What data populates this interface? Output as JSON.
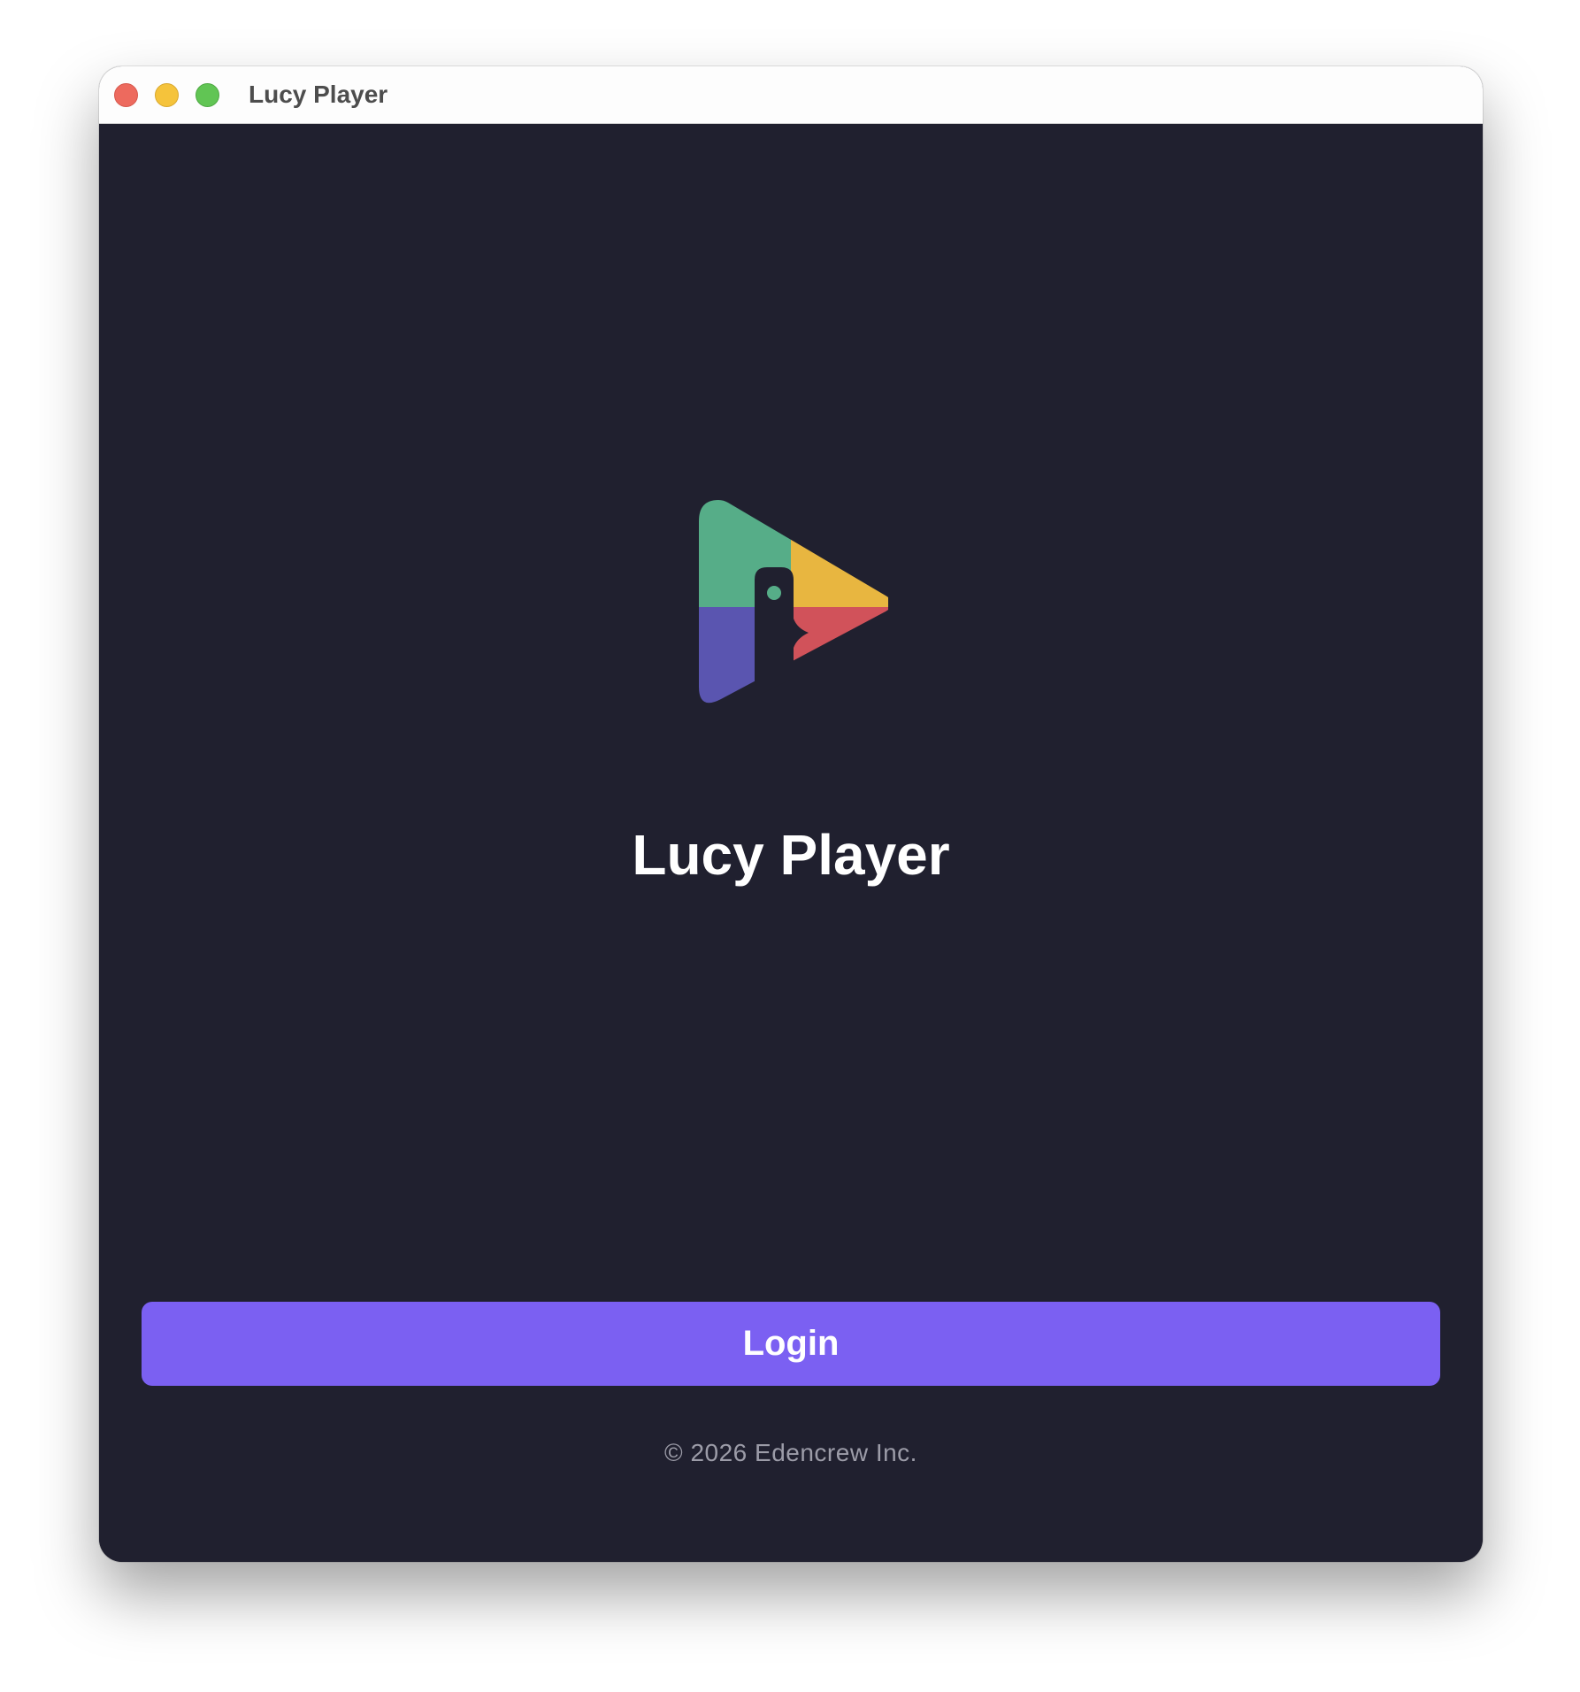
{
  "window": {
    "title": "Lucy Player"
  },
  "brand": {
    "app_name": "Lucy Player",
    "logo_icon": "lucy-player-logo",
    "logo_colors": {
      "green": "#56ad88",
      "yellow": "#e8b640",
      "purple": "#5a55b0",
      "red": "#d1525a"
    }
  },
  "actions": {
    "login_label": "Login"
  },
  "footer": {
    "copyright": "© 2026 Edencrew Inc."
  },
  "colors": {
    "background": "#20202f",
    "accent": "#7b60f2",
    "titlebar": "#fdfdfd"
  }
}
